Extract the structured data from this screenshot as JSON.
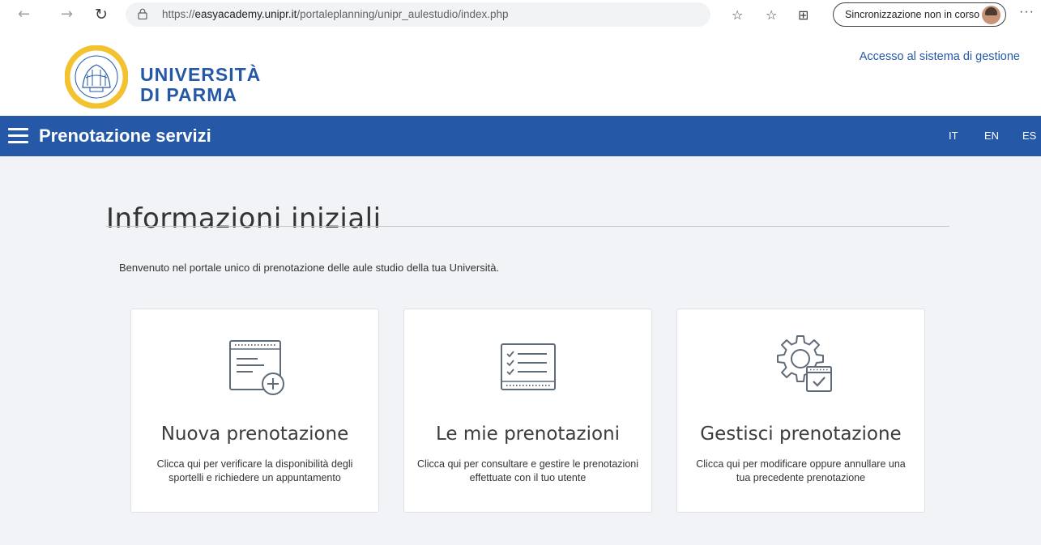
{
  "browser": {
    "url_prefix": "https://",
    "url_domain": "easyacademy.unipr.it",
    "url_path": "/portaleplanning/unipr_aulestudio/index.php",
    "sync_status": "Sincronizzazione non in corso"
  },
  "header": {
    "logo_line1": "UNIVERSITÀ",
    "logo_line2": "DI PARMA",
    "admin_link": "Accesso al sistema di gestione"
  },
  "navbar": {
    "title": "Prenotazione servizi",
    "languages": [
      "IT",
      "EN",
      "ES"
    ]
  },
  "main": {
    "title": "Informazioni iniziali",
    "welcome": "Benvenuto nel portale unico di prenotazione delle aule studio della tua Università.",
    "cards": [
      {
        "title": "Nuova prenotazione",
        "description": "Clicca qui per verificare la disponibilità degli sportelli e richiedere un appuntamento",
        "icon": "calendar-add-icon"
      },
      {
        "title": "Le mie prenotazioni",
        "description": "Clicca qui per consultare e gestire le prenotazioni effettuate con il tuo utente",
        "icon": "checklist-icon"
      },
      {
        "title": "Gestisci prenotazione",
        "description": "Clicca qui per modificare oppure annullare una tua precedente prenotazione",
        "icon": "gear-calendar-icon"
      }
    ]
  },
  "colors": {
    "brand_blue": "#2559a7",
    "page_bg": "#f1f3f6",
    "icon_gray": "#5f6b78"
  }
}
